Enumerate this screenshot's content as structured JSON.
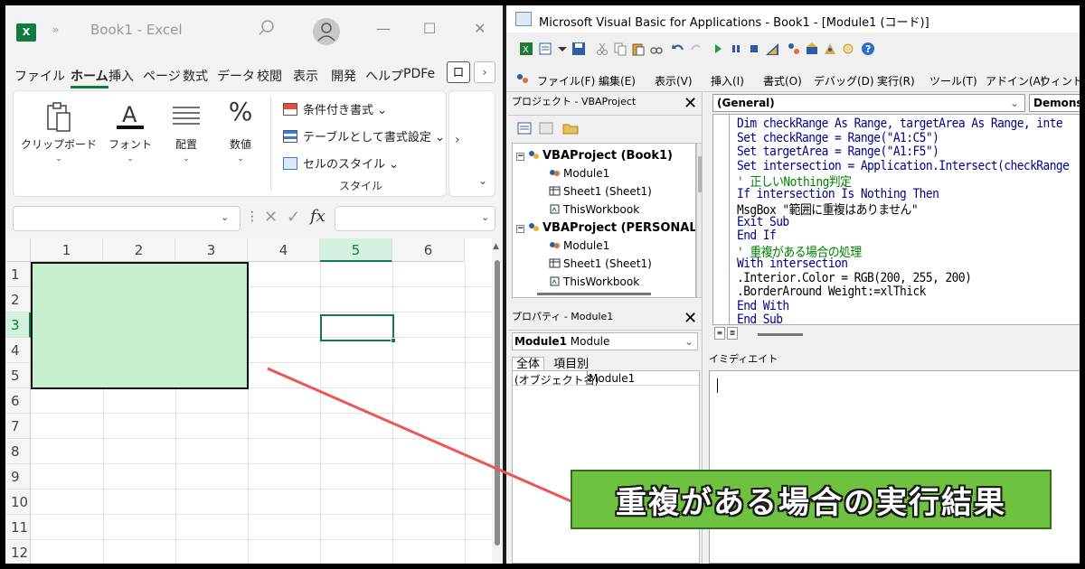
{
  "excel": {
    "more": "»",
    "book_title": "Book1 - Excel",
    "win_min": "—",
    "win_max": "☐",
    "win_close": "✕",
    "tabs": [
      "ファイル",
      "ホーム",
      "挿入",
      "ページ",
      "数式",
      "データ",
      "校閲",
      "表示",
      "開発",
      "ヘルプ",
      "PDFe"
    ],
    "active_tab": "ホーム",
    "comment_btn": "口",
    "scroll_right": "›",
    "ribbon": {
      "clipboard": "クリップボード",
      "font": "フォント",
      "alignment": "配置",
      "number": "数値",
      "number_glyph": "%",
      "conditional": "条件付き書式 ⌄",
      "table_format": "テーブルとして書式設定 ⌄",
      "cell_style": "セルのスタイル ⌄",
      "style_group": "スタイル",
      "expand": "›",
      "collapse": "⌄"
    },
    "formula": {
      "namebox_caret": "⌄",
      "dots": "⋮",
      "cancel": "✕",
      "enter": "✓",
      "fx": "fx",
      "bar_caret": "⌄"
    },
    "columns": [
      "1",
      "2",
      "3",
      "4",
      "5",
      "6"
    ],
    "selected_column": "5",
    "rows": [
      "1",
      "2",
      "3",
      "4",
      "5",
      "6",
      "7",
      "8",
      "9",
      "10",
      "11",
      "12"
    ],
    "selected_row": "3",
    "highlight_color": "#c6efce",
    "accent": "#107c41"
  },
  "vba": {
    "title": "Microsoft Visual Basic for Applications - Book1 - [Module1 (コード)]",
    "menu": [
      "ファイル(F)",
      "編集(E)",
      "表示(V)",
      "挿入(I)",
      "書式(O)",
      "デバッグ(D)",
      "実行(R)",
      "ツール(T)",
      "アドイン(A)",
      "ウィンドウ"
    ],
    "project_pane": {
      "title": "プロジェクト - VBAProject",
      "close": "✕",
      "tree": [
        {
          "label": "VBAProject (Book1)",
          "level": 0,
          "bold": true,
          "expander": "−"
        },
        {
          "label": "Module1",
          "level": 1
        },
        {
          "label": "Sheet1 (Sheet1)",
          "level": 1
        },
        {
          "label": "ThisWorkbook",
          "level": 1
        },
        {
          "label": "VBAProject (PERSONAL.X",
          "level": 0,
          "bold": true,
          "expander": "−"
        },
        {
          "label": "Module1",
          "level": 1
        },
        {
          "label": "Sheet1 (Sheet1)",
          "level": 1
        },
        {
          "label": "ThisWorkbook",
          "level": 1
        }
      ]
    },
    "properties_pane": {
      "title": "プロパティ - Module1",
      "close": "✕",
      "combo_name": "Module1",
      "combo_type": "Module",
      "combo_caret": "⌄",
      "tab_all": "全体",
      "tab_category": "項目別",
      "key": "(オブジェクト名)",
      "value": "Module1"
    },
    "code": {
      "object_combo": "(General)",
      "object_caret": "⌄",
      "proc_combo": "Demonstra",
      "lines": [
        {
          "text": "Dim checkRange As Range, targetArea As Range, inte",
          "kind": "kw"
        },
        {
          "text": "Set checkRange = Range(\"A1:C5\")",
          "kind": "kw"
        },
        {
          "text": "Set targetArea = Range(\"A1:F5\")",
          "kind": "kw"
        },
        {
          "text": "Set intersection = Application.Intersect(checkRange",
          "kind": "kw"
        },
        {
          "text": "' 正しいNothing判定",
          "kind": "cm"
        },
        {
          "text": "If intersection Is Nothing Then",
          "kind": "kw"
        },
        {
          "text": "MsgBox \"範囲に重複はありません\"",
          "kind": "plain"
        },
        {
          "text": "Exit Sub",
          "kind": "kw"
        },
        {
          "text": "End If",
          "kind": "kw"
        },
        {
          "text": "' 重複がある場合の処理",
          "kind": "cm"
        },
        {
          "text": "With intersection",
          "kind": "kw"
        },
        {
          "text": ".Interior.Color = RGB(200, 255, 200)",
          "kind": "plain"
        },
        {
          "text": ".BorderAround Weight:=xlThick",
          "kind": "plain"
        },
        {
          "text": "End With",
          "kind": "kw"
        },
        {
          "text": "End Sub",
          "kind": "kw"
        }
      ],
      "view_proc": "≡",
      "view_full": "≣"
    },
    "immediate": {
      "title": "イミディエイト"
    }
  },
  "callout": {
    "text": "重複がある場合の実行結果",
    "color": "#6fc23f"
  }
}
